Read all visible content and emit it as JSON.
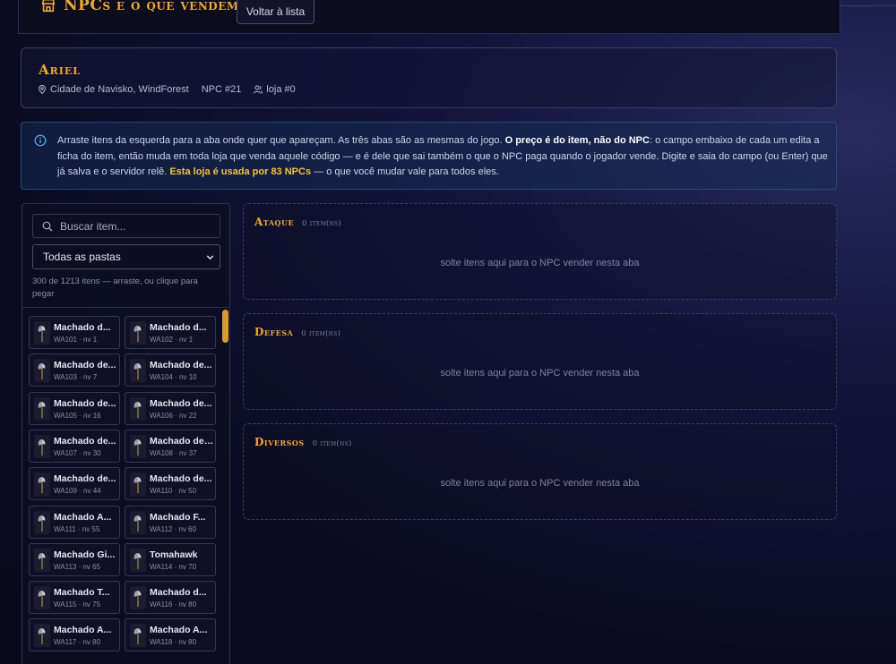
{
  "header": {
    "title": "NPCs e o que vendem",
    "back_label": "Voltar à lista"
  },
  "npc": {
    "name": "Ariel",
    "location": "Cidade de Navisko, WindForest",
    "npc_id": "NPC #21",
    "shop": "loja #0"
  },
  "info": {
    "text_1": "Arraste itens da esquerda para a aba onde quer que apareçam. As três abas são as mesmas do jogo. ",
    "bold_1": "O preço é do item, não do NPC",
    "text_2": ": o campo embaixo de cada um edita a ficha do item, então muda em toda loja que venda aquele código — e é dele que sai também o que o NPC paga quando o jogador vende. Digite e saia do campo (ou Enter) que já salva e o servidor relê. ",
    "highlight": "Esta loja é usada por 83 NPCs",
    "text_3": " — o que você mudar vale para todos eles."
  },
  "catalog": {
    "search_placeholder": "Buscar item...",
    "folder_selected": "Todas as pastas",
    "count_text": "300 de 1213 itens — arraste, ou clique para pegar",
    "items": [
      {
        "name": "Machado d...",
        "sub": "WA101 · nv 1"
      },
      {
        "name": "Machado d...",
        "sub": "WA102 · nv 1"
      },
      {
        "name": "Machado de...",
        "sub": "WA103 · nv 7"
      },
      {
        "name": "Machado de...",
        "sub": "WA104 · nv 10"
      },
      {
        "name": "Machado de...",
        "sub": "WA105 · nv 16"
      },
      {
        "name": "Machado de...",
        "sub": "WA106 · nv 22"
      },
      {
        "name": "Machado de...",
        "sub": "WA107 · nv 30"
      },
      {
        "name": "Machado de ...",
        "sub": "WA108 · nv 37"
      },
      {
        "name": "Machado de...",
        "sub": "WA109 · nv 44"
      },
      {
        "name": "Machado de...",
        "sub": "WA110 · nv 50"
      },
      {
        "name": "Machado A...",
        "sub": "WA111 · nv 55"
      },
      {
        "name": "Machado F...",
        "sub": "WA112 · nv 60"
      },
      {
        "name": "Machado Gi...",
        "sub": "WA113 · nv 65"
      },
      {
        "name": "Tomahawk",
        "sub": "WA114 · nv 70"
      },
      {
        "name": "Machado T...",
        "sub": "WA115 · nv 75"
      },
      {
        "name": "Machado d...",
        "sub": "WA116 · nv 80"
      },
      {
        "name": "Machado A...",
        "sub": "WA117 · nv 80"
      },
      {
        "name": "Machado A...",
        "sub": "WA118 · nv 80"
      }
    ]
  },
  "tabs": [
    {
      "name": "Ataque",
      "count": "0 item(ns)",
      "empty": "solte itens aqui para o NPC vender nesta aba"
    },
    {
      "name": "Defesa",
      "count": "0 item(ns)",
      "empty": "solte itens aqui para o NPC vender nesta aba"
    },
    {
      "name": "Diversos",
      "count": "0 item(ns)",
      "empty": "solte itens aqui para o NPC vender nesta aba"
    }
  ],
  "colors": {
    "accent": "#f0a836",
    "highlight": "#f5c242",
    "background": "#0a0b22"
  },
  "icons": {
    "header": "shop-icon",
    "location": "map-pin-icon",
    "shop": "users-icon",
    "info": "info-icon",
    "search": "search-icon",
    "select": "chevron-down-icon",
    "item": "axe-icon"
  }
}
